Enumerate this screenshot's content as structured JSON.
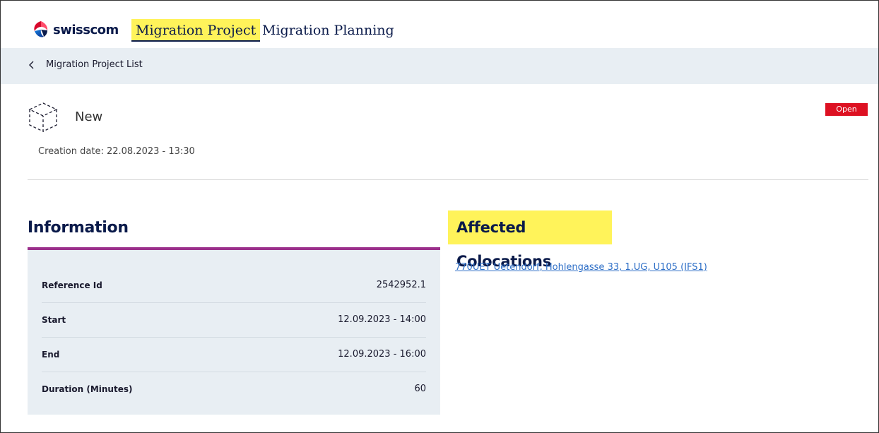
{
  "brand": {
    "name": "swisscom",
    "icon": "swisscom-logo"
  },
  "nav": {
    "tabs": [
      {
        "label": "Migration Project",
        "active": true
      },
      {
        "label": "Migration Planning",
        "active": false
      }
    ]
  },
  "breadcrumb": {
    "label": "Migration Project List",
    "icon": "chevron-left-icon"
  },
  "project": {
    "icon": "cube-outline-icon",
    "title": "New",
    "creation_date": "Creation date: 22.08.2023 - 13:30",
    "status": "Open"
  },
  "information": {
    "heading": "Information",
    "rows": [
      {
        "label": "Reference Id",
        "value": "2542952.1"
      },
      {
        "label": "Start",
        "value": "12.09.2023 - 14:00"
      },
      {
        "label": "End",
        "value": "12.09.2023 - 16:00"
      },
      {
        "label": "Duration (Minutes)",
        "value": "60"
      }
    ]
  },
  "colocations": {
    "heading": "Affected Colocations",
    "items": [
      {
        "label": "770UET Uetendorf, Hohlengasse 33, 1.UG, U105 (IFS1)"
      }
    ]
  },
  "colors": {
    "highlight": "#fff35a",
    "accent_border": "#9b2f8b",
    "status_open": "#dd1122",
    "link": "#2e6fc7",
    "panel_bg": "#e8eef3"
  }
}
